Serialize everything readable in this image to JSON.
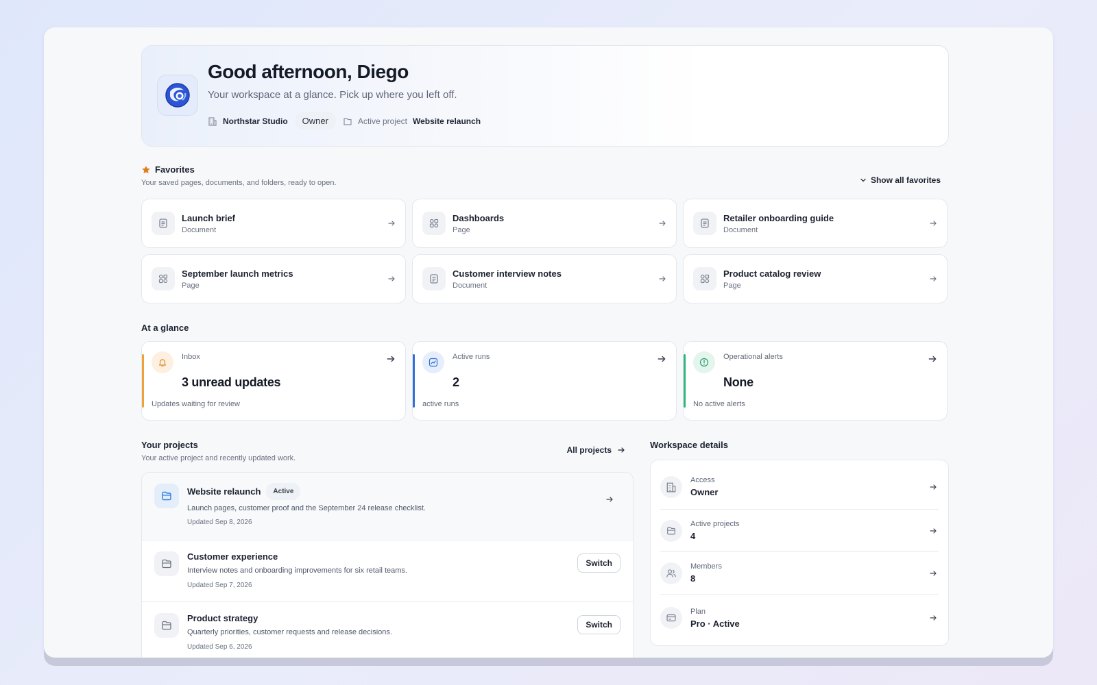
{
  "hero": {
    "title": "Good afternoon, Diego",
    "subtitle": "Your workspace at a glance. Pick up where you left off.",
    "org_name": "Northstar Studio",
    "role": "Owner",
    "active_project_label": "Active project",
    "active_project_name": "Website relaunch"
  },
  "favorites": {
    "title": "Favorites",
    "subtitle": "Your saved pages, documents, and folders, ready to open.",
    "show_all": "Show all favorites",
    "items": [
      {
        "name": "Launch brief",
        "type": "Document",
        "icon": "document-icon"
      },
      {
        "name": "Dashboards",
        "type": "Page",
        "icon": "page-icon"
      },
      {
        "name": "Retailer onboarding guide",
        "type": "Document",
        "icon": "document-icon"
      },
      {
        "name": "September launch metrics",
        "type": "Page",
        "icon": "page-icon"
      },
      {
        "name": "Customer interview notes",
        "type": "Document",
        "icon": "document-icon"
      },
      {
        "name": "Product catalog review",
        "type": "Page",
        "icon": "page-icon"
      }
    ]
  },
  "glance": {
    "title": "At a glance",
    "cards": [
      {
        "label": "Inbox",
        "value": "3 unread updates",
        "note": "Updates waiting for review",
        "icon": "bell-icon",
        "accent": "#f0a23a"
      },
      {
        "label": "Active runs",
        "value": "2",
        "note": "active runs",
        "icon": "chart-icon",
        "accent": "#2f6fd6"
      },
      {
        "label": "Operational alerts",
        "value": "None",
        "note": "No active alerts",
        "icon": "alert-icon",
        "accent": "#2fb67a"
      }
    ]
  },
  "projects": {
    "title": "Your projects",
    "subtitle": "Your active project and recently updated work.",
    "all_label": "All projects",
    "items": [
      {
        "name": "Website relaunch",
        "status": "Active",
        "desc": "Launch pages, customer proof and the September 24 release checklist.",
        "updated": "Updated Sep 8, 2026"
      },
      {
        "name": "Customer experience",
        "desc": "Interview notes and onboarding improvements for six retail teams.",
        "updated": "Updated Sep 7, 2026",
        "action": "Switch"
      },
      {
        "name": "Product strategy",
        "desc": "Quarterly priorities, customer requests and release decisions.",
        "updated": "Updated Sep 6, 2026",
        "action": "Switch"
      }
    ]
  },
  "workspace": {
    "title": "Workspace details",
    "items": [
      {
        "label": "Access",
        "value": "Owner",
        "icon": "building-icon"
      },
      {
        "label": "Active projects",
        "value": "4",
        "icon": "folder-icon"
      },
      {
        "label": "Members",
        "value": "8",
        "icon": "users-icon"
      },
      {
        "label": "Plan",
        "value": "Pro · Active",
        "icon": "card-icon"
      }
    ]
  },
  "colors": {
    "favorite_star": "#e27c1a",
    "inbox_accent": "#f0a23a",
    "runs_accent": "#2f6fd6",
    "alerts_accent": "#2fb67a",
    "active_project_icon": "#2f7de0"
  }
}
